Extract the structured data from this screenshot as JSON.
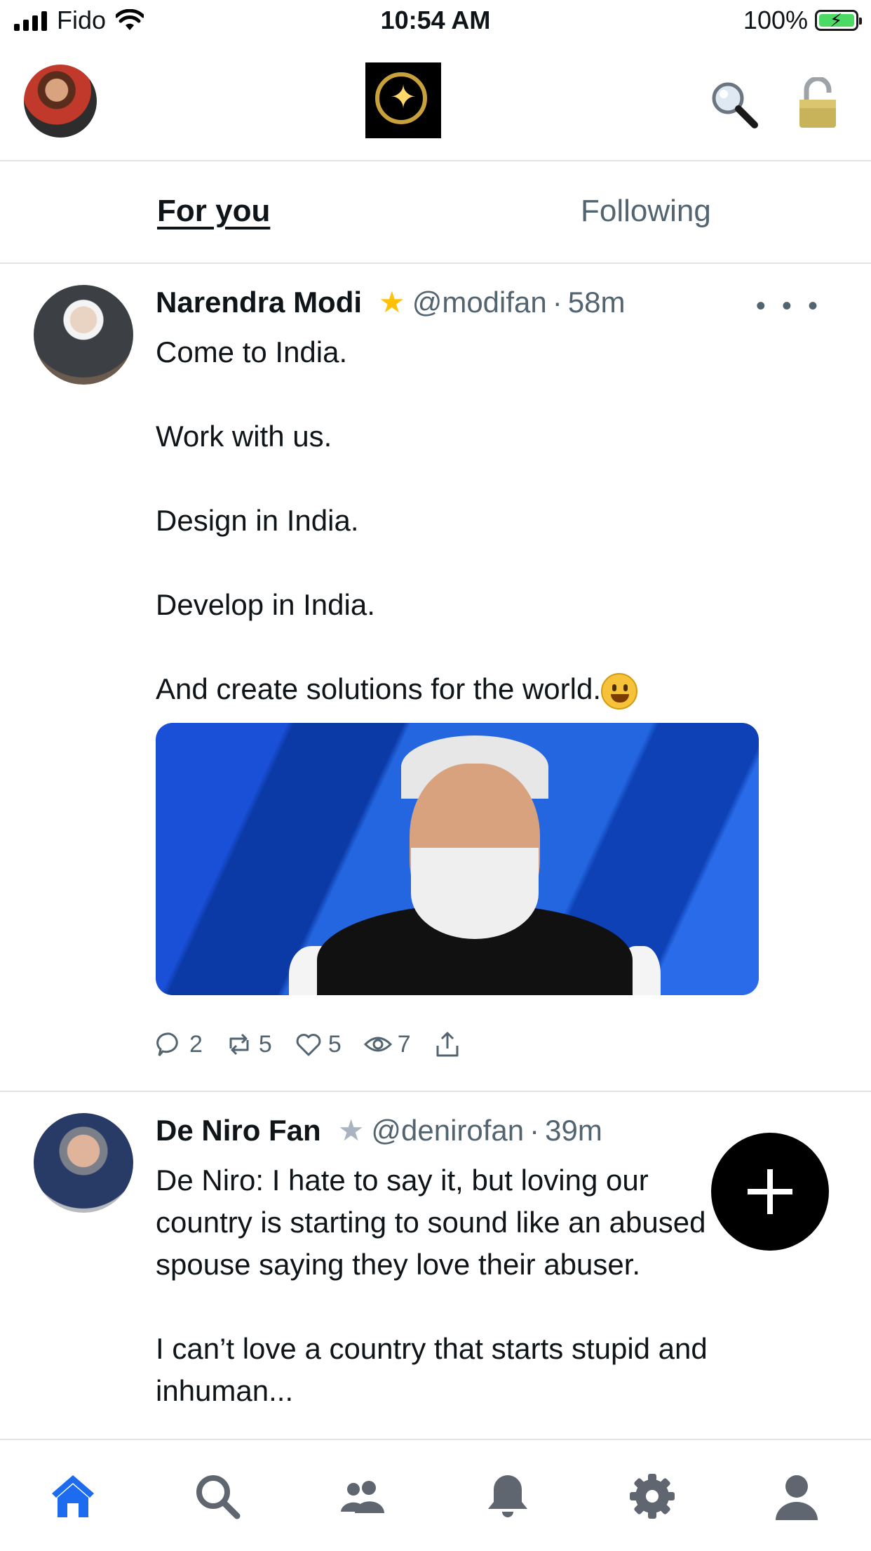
{
  "status_bar": {
    "carrier": "Fido",
    "time": "10:54 AM",
    "battery": "100%"
  },
  "header": {
    "logo_icon": "app-logo-star-bubble",
    "search_icon": "magnifying-glass-icon",
    "lock_icon": "lock-icon"
  },
  "tabs": [
    {
      "label": "For you",
      "selected": true
    },
    {
      "label": "Following",
      "selected": false
    }
  ],
  "posts": [
    {
      "name": "Narendra Modi",
      "handle": "@modifan",
      "time": "58m",
      "star": "★",
      "star_color": "#ffc107",
      "body": [
        "Come to India.",
        "Work with us.",
        "Design in India.",
        "Develop in India.",
        "And create solutions for the world."
      ],
      "has_image": true,
      "stats": {
        "replies": "2",
        "reposts": "5",
        "likes": "5",
        "views": "7"
      }
    },
    {
      "name": "De Niro Fan",
      "handle": "@denirofan",
      "time": "39m",
      "star": "★",
      "star_color": "#aab4c0",
      "body": [
        "De Niro: I hate to say it, but loving our country is starting to sound like an abused spouse saying they love their abuser.",
        "I can’t love a country that starts stupid and inhuman..."
      ]
    }
  ],
  "separator": "·",
  "more": "• • •",
  "bottom_nav": [
    {
      "icon": "home-icon",
      "active": true
    },
    {
      "icon": "search-icon",
      "active": false
    },
    {
      "icon": "community-icon",
      "active": false
    },
    {
      "icon": "bell-icon",
      "active": false
    },
    {
      "icon": "settings-icon",
      "active": false
    },
    {
      "icon": "profile-icon",
      "active": false
    }
  ],
  "colors": {
    "accent": "#1d6cf0",
    "muted": "#536471",
    "divider": "#e1e4e7",
    "nav_inactive": "#5f6670"
  }
}
